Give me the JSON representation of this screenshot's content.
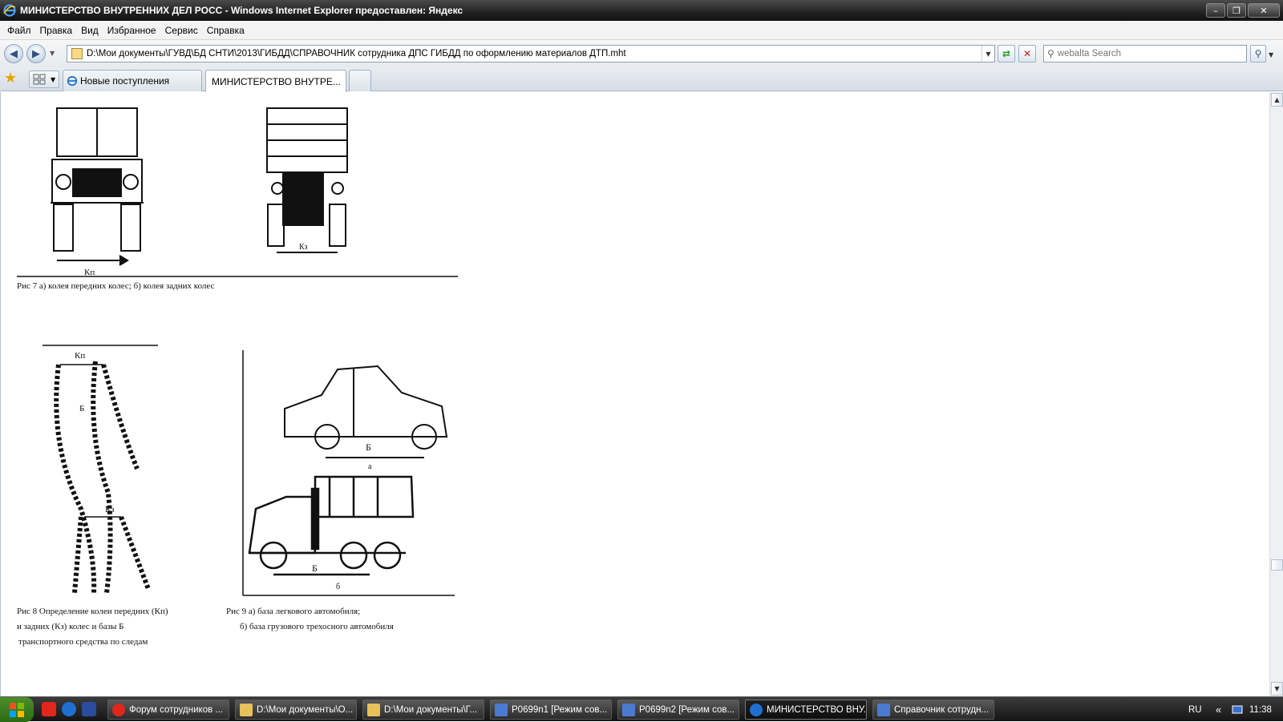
{
  "window": {
    "title": "МИНИСТЕРСТВО ВНУТРЕННИХ ДЕЛ РОСС - Windows Internet Explorer предоставлен: Яндекс",
    "buttons": {
      "minimize": "–",
      "maximize": "❐",
      "close": "✕"
    }
  },
  "menu": [
    "Файл",
    "Правка",
    "Вид",
    "Избранное",
    "Сервис",
    "Справка"
  ],
  "address": {
    "url": "D:\\Мои документы\\ГУВД\\БД СНТИ\\2013\\ГИБДД\\СПРАВОЧНИК сотрудника ДПС ГИБДД по оформлению материалов ДТП.mht"
  },
  "search": {
    "placeholder": "webalta Search"
  },
  "tabs": [
    {
      "label": "Новые поступления"
    },
    {
      "label": "МИНИСТЕРСТВО ВНУТРЕ..."
    }
  ],
  "figures": {
    "fig7": {
      "label_kp": "Кп",
      "label_kz": "Кз",
      "caption": "Рис 7  а) колея передних колес; б) колея задних колес"
    },
    "fig8": {
      "label_kp": "Кп",
      "label_b": "Б",
      "label_kz": "Кз",
      "caption_lines": [
        "Рис 8  Определение колеи передних (Кп)",
        "и задних (Кз) колес и базы Б",
        "транспортного средства по следам"
      ]
    },
    "fig9": {
      "label_b1": "Б",
      "label_a": "а",
      "label_b2": "Б",
      "label_b": "б",
      "caption_lines": [
        "Рис  9  а) база легкового автомобиля;",
        "б) база грузового трехосного автомобиля"
      ]
    }
  },
  "taskbar": {
    "items": [
      {
        "label": "Форум сотрудников ..."
      },
      {
        "label": "D:\\Мои документы\\О..."
      },
      {
        "label": "D:\\Мои документы\\Г..."
      },
      {
        "label": "P0699n1  [Режим сов..."
      },
      {
        "label": "P0699n2  [Режим сов..."
      },
      {
        "label": "МИНИСТЕРСТВО ВНУ..."
      },
      {
        "label": "Справочник сотрудн..."
      }
    ],
    "lang": "RU",
    "clock": "11:38"
  },
  "colors": {
    "ie_blue": "#1f6fd1",
    "yandex_red": "#e1261c",
    "taskbar": "#1e1e1e"
  }
}
